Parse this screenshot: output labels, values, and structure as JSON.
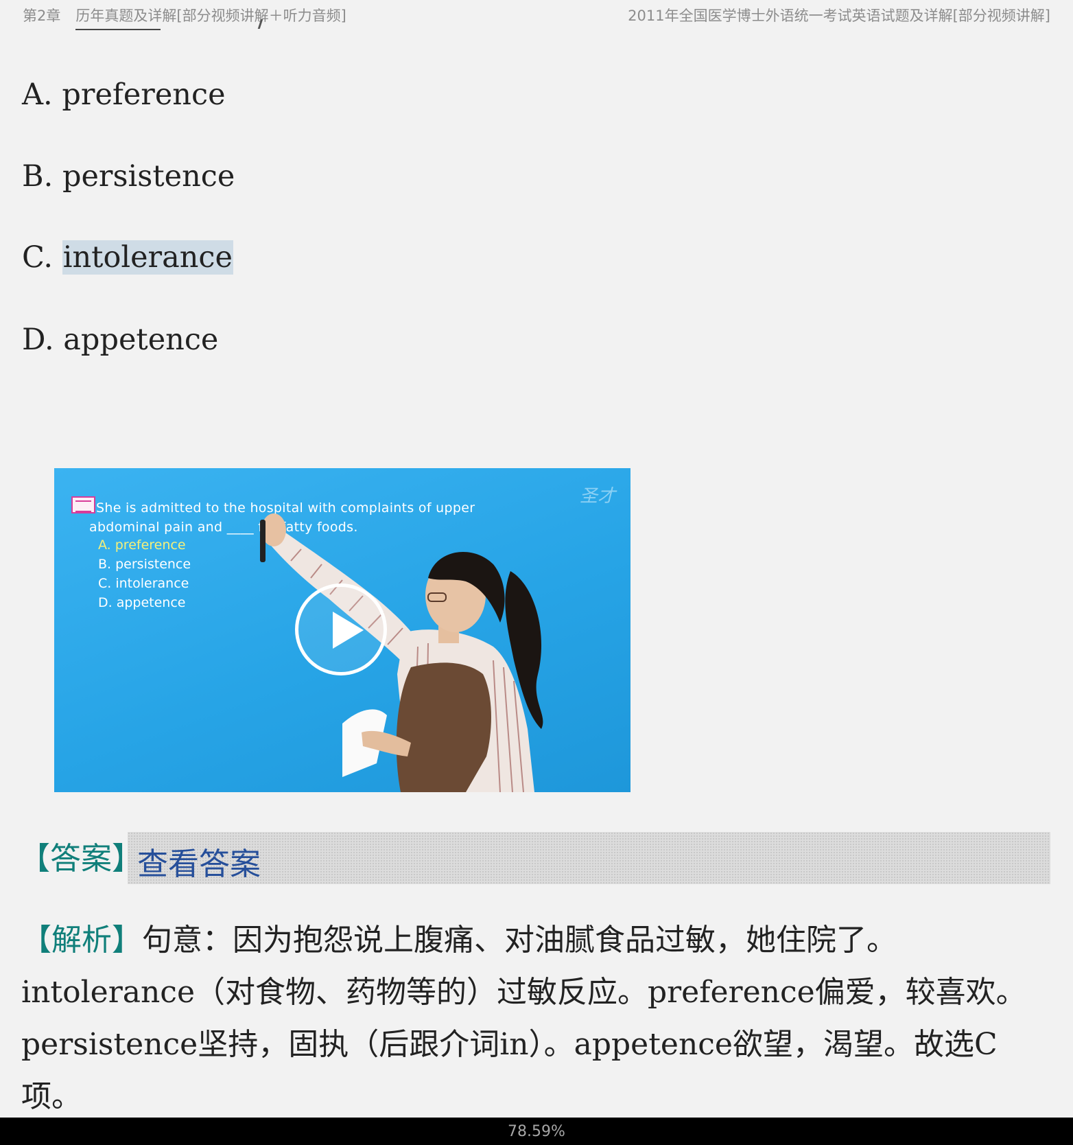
{
  "header": {
    "chapter": "第2章",
    "section": "历年真题及详解[部分视频讲解＋听力音频]",
    "book_title": "2011年全国医学博士外语统一考试英语试题及详解[部分视频讲解]"
  },
  "options": [
    {
      "letter": "A.",
      "text": "preference"
    },
    {
      "letter": "B.",
      "text": "persistence"
    },
    {
      "letter": "C.",
      "text": "intolerance",
      "highlighted": true
    },
    {
      "letter": "D.",
      "text": "appetence"
    }
  ],
  "video": {
    "question_line1": "She is admitted to the hospital with complaints of upper",
    "question_line2": "abdominal pain and ____ for fatty foods.",
    "options": [
      "A. preference",
      "B. persistence",
      "C. intolerance",
      "D. appetence"
    ],
    "logo": "圣才",
    "play_icon": "play-icon",
    "colors": {
      "background": "#2aa8ea",
      "selected_option": "#f5f07a"
    }
  },
  "answer": {
    "label": "【答案】",
    "link_text": "查看答案"
  },
  "analysis": {
    "label": "【解析】",
    "text1": "句意：因为抱怨说上腹痛、对油腻食品过敏，她住院了。",
    "text2": "intolerance（对食物、药物等的）过敏反应。preference偏爱，较喜欢。",
    "text3": "persistence坚持，固执（后跟介词in）。appetence欲望，渴望。故选C",
    "text4": "项。"
  },
  "colors": {
    "label_teal": "#107f7a",
    "link_blue": "#264f9a",
    "highlight": "#cfdce6",
    "page_bg": "#f2f2f2"
  },
  "status": {
    "progress": "78.59%"
  }
}
